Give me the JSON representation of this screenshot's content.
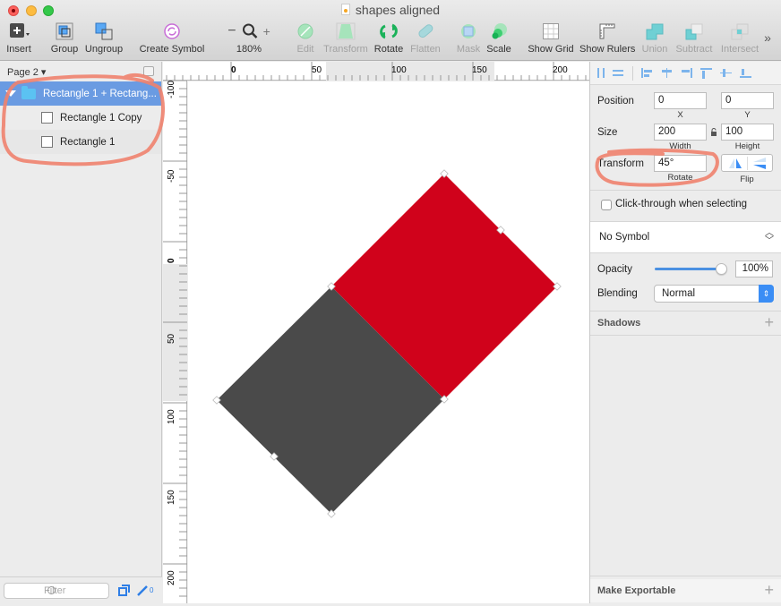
{
  "window": {
    "title": "shapes aligned"
  },
  "toolbar": {
    "items": [
      {
        "id": "insert",
        "label": "Insert",
        "enabled": true
      },
      {
        "id": "group",
        "label": "Group",
        "enabled": true
      },
      {
        "id": "ungroup",
        "label": "Ungroup",
        "enabled": true
      },
      {
        "id": "create_symbol",
        "label": "Create Symbol",
        "enabled": true
      },
      {
        "id": "zoom",
        "label": "180%",
        "enabled": true
      },
      {
        "id": "edit",
        "label": "Edit",
        "enabled": false
      },
      {
        "id": "transform",
        "label": "Transform",
        "enabled": false
      },
      {
        "id": "rotate",
        "label": "Rotate",
        "enabled": true
      },
      {
        "id": "flatten",
        "label": "Flatten",
        "enabled": false
      },
      {
        "id": "mask",
        "label": "Mask",
        "enabled": false
      },
      {
        "id": "scale",
        "label": "Scale",
        "enabled": true
      },
      {
        "id": "show_grid",
        "label": "Show Grid",
        "enabled": true
      },
      {
        "id": "show_rulers",
        "label": "Show Rulers",
        "enabled": true
      },
      {
        "id": "union",
        "label": "Union",
        "enabled": false
      },
      {
        "id": "subtract",
        "label": "Subtract",
        "enabled": false
      },
      {
        "id": "intersect",
        "label": "Intersect",
        "enabled": false
      }
    ],
    "zoom_minus": "−",
    "zoom_plus": "+",
    "overflow": "»"
  },
  "sidebar": {
    "page": "Page 2 ▾",
    "layers": [
      {
        "name": "Rectangle 1 + Rectang...",
        "type": "group",
        "selected": true,
        "expanded": true
      },
      {
        "name": "Rectangle 1 Copy",
        "type": "rect",
        "selected": false
      },
      {
        "name": "Rectangle 1",
        "type": "rect",
        "selected": false
      }
    ],
    "filter_placeholder": "Filter",
    "edit_count": "0"
  },
  "rulers": {
    "top": [
      "0",
      "50",
      "100",
      "150",
      "200"
    ],
    "left": [
      "-100",
      "-50",
      "0",
      "50",
      "100",
      "150",
      "200"
    ]
  },
  "canvas": {
    "shapes": [
      {
        "name": "Rectangle 1 Copy",
        "color": "#d0021b"
      },
      {
        "name": "Rectangle 1",
        "color": "#4a4a4a"
      }
    ]
  },
  "inspector": {
    "position": {
      "label": "Position",
      "x": "0",
      "y": "0",
      "x_label": "X",
      "y_label": "Y"
    },
    "size": {
      "label": "Size",
      "width": "200",
      "height": "100",
      "w_label": "Width",
      "h_label": "Height"
    },
    "transform": {
      "label": "Transform",
      "rotate": "45°",
      "rotate_label": "Rotate",
      "flip_label": "Flip"
    },
    "click_through": {
      "label": "Click-through when selecting",
      "checked": false
    },
    "symbol": {
      "value": "No Symbol"
    },
    "opacity": {
      "label": "Opacity",
      "value": "100%",
      "level": 1.0
    },
    "blending": {
      "label": "Blending",
      "value": "Normal"
    },
    "shadows": {
      "label": "Shadows"
    },
    "exportable": {
      "label": "Make Exportable"
    }
  },
  "colors": {
    "selection": "#6a9be2",
    "accent": "#3a8df5",
    "annotation": "#f0826e"
  }
}
